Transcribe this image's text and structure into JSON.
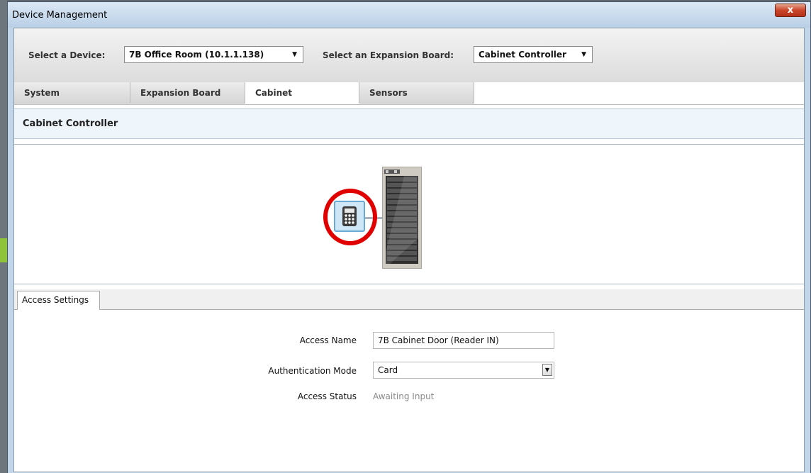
{
  "window": {
    "title": "Device Management",
    "close_glyph": "x"
  },
  "toolbar": {
    "device_label": "Select a Device:",
    "device_value": "7B Office Room (10.1.1.138)",
    "board_label": "Select an Expansion Board:",
    "board_value": "Cabinet Controller"
  },
  "tabs": [
    {
      "label": "System",
      "active": false
    },
    {
      "label": "Expansion Board",
      "active": false
    },
    {
      "label": "Cabinet",
      "active": true
    },
    {
      "label": "Sensors",
      "active": false
    }
  ],
  "section": {
    "title": "Cabinet Controller"
  },
  "diagram": {
    "keypad_icon": "keypad-icon",
    "cabinet_icon": "server-cabinet-icon",
    "highlight_color": "#e00000"
  },
  "settings": {
    "tab_label": "Access Settings",
    "access_name_label": "Access Name",
    "access_name_value": "7B Cabinet Door (Reader IN)",
    "auth_mode_label": "Authentication Mode",
    "auth_mode_value": "Card",
    "status_label": "Access Status",
    "status_value": "Awaiting Input"
  },
  "colors": {
    "accent": "#6aaad6",
    "window_chrome": "#c2d6ea"
  }
}
